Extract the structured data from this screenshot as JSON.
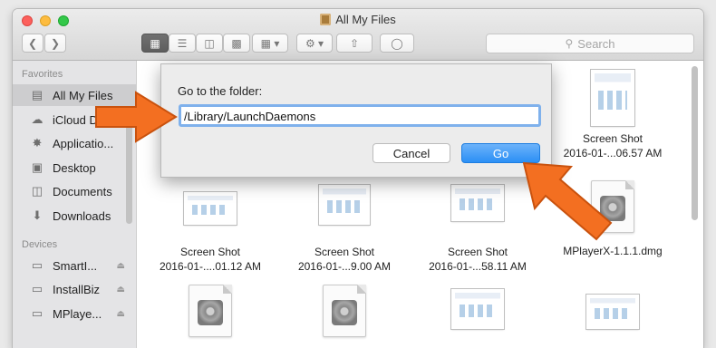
{
  "window": {
    "title": "All My Files"
  },
  "toolbar": {
    "back_icon": "chevron-left-icon",
    "forward_icon": "chevron-right-icon",
    "view_icons": [
      "icon-view",
      "list-view",
      "column-view",
      "coverflow-view"
    ],
    "search_placeholder": "Search"
  },
  "sidebar": {
    "favorites_header": "Favorites",
    "favorites": [
      {
        "label": "All My Files",
        "icon": "all-files-icon",
        "selected": true
      },
      {
        "label": "iCloud D",
        "icon": "cloud-icon"
      },
      {
        "label": "Applicatio...",
        "icon": "applications-icon"
      },
      {
        "label": "Desktop",
        "icon": "desktop-icon"
      },
      {
        "label": "Documents",
        "icon": "documents-icon"
      },
      {
        "label": "Downloads",
        "icon": "downloads-icon"
      }
    ],
    "devices_header": "Devices",
    "devices": [
      {
        "label": "SmartI...",
        "icon": "drive-icon"
      },
      {
        "label": "InstallBiz",
        "icon": "drive-icon"
      },
      {
        "label": "MPlaye...",
        "icon": "drive-icon"
      }
    ]
  },
  "files": [
    {
      "line1": "Screen Shot",
      "line2": "2016-01-...06.57 AM",
      "kind": "screenshot"
    },
    {
      "line1": "Screen Shot",
      "line2": "2016-01-....01.12 AM",
      "kind": "screenshot"
    },
    {
      "line1": "Screen Shot",
      "line2": "2016-01-...9.00 AM",
      "kind": "screenshot"
    },
    {
      "line1": "Screen Shot",
      "line2": "2016-01-...58.11 AM",
      "kind": "screenshot"
    },
    {
      "line1": "MPlayerX-1.1.1.dmg",
      "line2": "",
      "kind": "dmg"
    }
  ],
  "dialog": {
    "prompt": "Go to the folder:",
    "path_value": "/Library/LaunchDaemons",
    "cancel_label": "Cancel",
    "go_label": "Go"
  },
  "colors": {
    "accent": "#2b8ff5",
    "arrow": "#f36f21"
  }
}
